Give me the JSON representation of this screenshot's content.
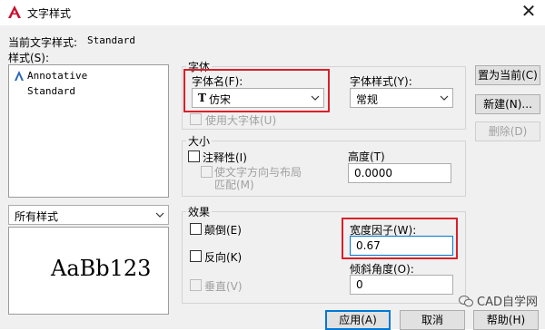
{
  "window": {
    "title": "文字样式",
    "close_glyph": "✕"
  },
  "current_style": {
    "label": "当前文字样式:",
    "value": "Standard"
  },
  "styles": {
    "label": "样式(S):",
    "items": [
      {
        "name": "Annotative",
        "annotative": true
      },
      {
        "name": "Standard",
        "annotative": false
      }
    ],
    "filter": {
      "value": "所有样式"
    }
  },
  "preview": {
    "text": "AaBb123"
  },
  "font_group": {
    "label": "字体",
    "font_name_label": "字体名(F):",
    "font_name_value": "仿宋",
    "font_type_glyph": "T",
    "font_style_label": "字体样式(Y):",
    "font_style_value": "常规",
    "bigfont_label": "使用大字体(U)"
  },
  "size_group": {
    "label": "大小",
    "annotative_label": "注释性(I)",
    "match_orientation_label_1": "使文字方向与布局",
    "match_orientation_label_2": "匹配(M)",
    "height_label": "高度(T)",
    "height_value": "0.0000"
  },
  "effects_group": {
    "label": "效果",
    "upside_down_label": "颠倒(E)",
    "backwards_label": "反向(K)",
    "vertical_label": "垂直(V)",
    "width_factor_label": "宽度因子(W):",
    "width_factor_value": "0.67",
    "oblique_label": "倾斜角度(O):",
    "oblique_value": "0"
  },
  "buttons": {
    "set_current": "置为当前(C)",
    "new": "新建(N)...",
    "delete": "删除(D)",
    "apply": "应用(A)",
    "cancel": "取消",
    "help": "帮助(H)"
  },
  "watermark": {
    "text": "CAD自学网"
  },
  "colors": {
    "accent": "#0078d7",
    "highlight_box": "#d9202a",
    "autocad_red": "#c8102e"
  }
}
